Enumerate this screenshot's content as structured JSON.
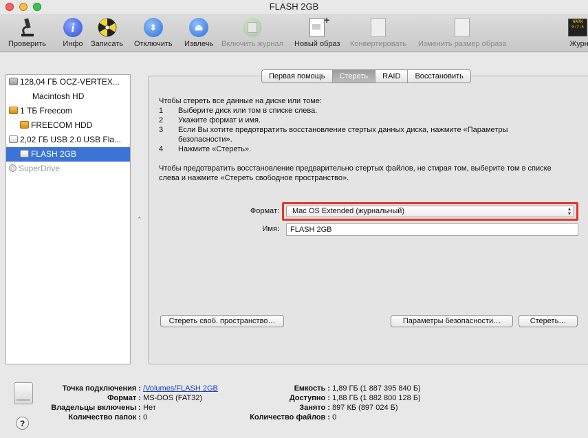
{
  "window": {
    "title": "FLASH 2GB"
  },
  "colors": {
    "accent": "#3b74d4",
    "highlight": "#e0362a"
  },
  "toolbar": [
    {
      "label": "Проверить",
      "icon": "microscope-icon",
      "disabled": false
    },
    {
      "label": "Инфо",
      "icon": "info-icon",
      "disabled": false
    },
    {
      "label": "Записать",
      "icon": "burn-icon",
      "disabled": false
    },
    {
      "label": "Отключить",
      "icon": "unmount-icon",
      "disabled": false
    },
    {
      "label": "Извлечь",
      "icon": "eject-icon",
      "disabled": false
    },
    {
      "label": "Включить журнал",
      "icon": "journal-icon",
      "disabled": true
    },
    {
      "label": "Новый образ",
      "icon": "new-image-icon",
      "disabled": false
    },
    {
      "label": "Конвертировать",
      "icon": "convert-icon",
      "disabled": true
    },
    {
      "label": "Изменить размер образа",
      "icon": "resize-icon",
      "disabled": true
    },
    {
      "label": "Журн",
      "icon": "log-icon",
      "disabled": false
    }
  ],
  "sidebar": {
    "items": [
      {
        "label": "128,04 ГБ OCZ-VERTEX...",
        "icon": "hdd-icon",
        "child": false
      },
      {
        "label": "Macintosh HD",
        "icon": "",
        "child": true
      },
      {
        "label": "1 ТБ Freecom",
        "icon": "external-drive-icon",
        "child": false
      },
      {
        "label": "FREECOM HDD",
        "icon": "external-drive-icon",
        "child": true
      },
      {
        "label": "2,02 ГБ USB 2.0 USB Fla...",
        "icon": "usb-drive-icon",
        "child": false
      },
      {
        "label": "FLASH 2GB",
        "icon": "usb-drive-icon",
        "child": true,
        "selected": true
      },
      {
        "label": "SuperDrive",
        "icon": "optical-drive-icon",
        "child": false,
        "dim": true
      }
    ]
  },
  "tabs": [
    {
      "label": "Первая помощь",
      "active": false
    },
    {
      "label": "Стереть",
      "active": true
    },
    {
      "label": "RAID",
      "active": false
    },
    {
      "label": "Восстановить",
      "active": false
    }
  ],
  "instructions": {
    "intro": "Чтобы стереть все данные на диске или томе:",
    "steps": [
      {
        "n": "1",
        "text": "Выберите диск или том в списке слева."
      },
      {
        "n": "2",
        "text": "Укажите формат и имя."
      },
      {
        "n": "3",
        "text": "Если Вы хотите предотвратить восстановление стертых данных диска, нажмите «Параметры безопасности»."
      },
      {
        "n": "4",
        "text": "Нажмите «Стереть»."
      }
    ],
    "free_space_note": "Чтобы предотвратить восстановление предварительно стертых файлов, не стирая том, выберите том в списке слева и нажмите «Стереть свободное пространство»."
  },
  "form": {
    "format_label": "Формат:",
    "format_value": "Mac OS Extended (журнальный)",
    "name_label": "Имя:",
    "name_value": "FLASH 2GB"
  },
  "buttons": {
    "erase_free_space": "Стереть своб. пространство…",
    "security_options": "Параметры безопасности…",
    "erase": "Стереть…"
  },
  "info": {
    "left": [
      {
        "key": "Точка подключения :",
        "value": "/Volumes/FLASH 2GB",
        "link": true
      },
      {
        "key": "Формат :",
        "value": "MS-DOS (FAT32)",
        "link": false
      },
      {
        "key": "Владельцы включены :",
        "value": "Нет",
        "link": false
      },
      {
        "key": "Количество папок :",
        "value": "0",
        "link": false
      }
    ],
    "right": [
      {
        "key": "Емкость :",
        "value": "1,89 ГБ (1 887 395 840 Б)"
      },
      {
        "key": "Доступно :",
        "value": "1,88 ГБ (1 882 800 128 Б)"
      },
      {
        "key": "Занято :",
        "value": "897 КБ (897 024 Б)"
      },
      {
        "key": "Количество файлов :",
        "value": "0"
      }
    ],
    "help_label": "?"
  }
}
